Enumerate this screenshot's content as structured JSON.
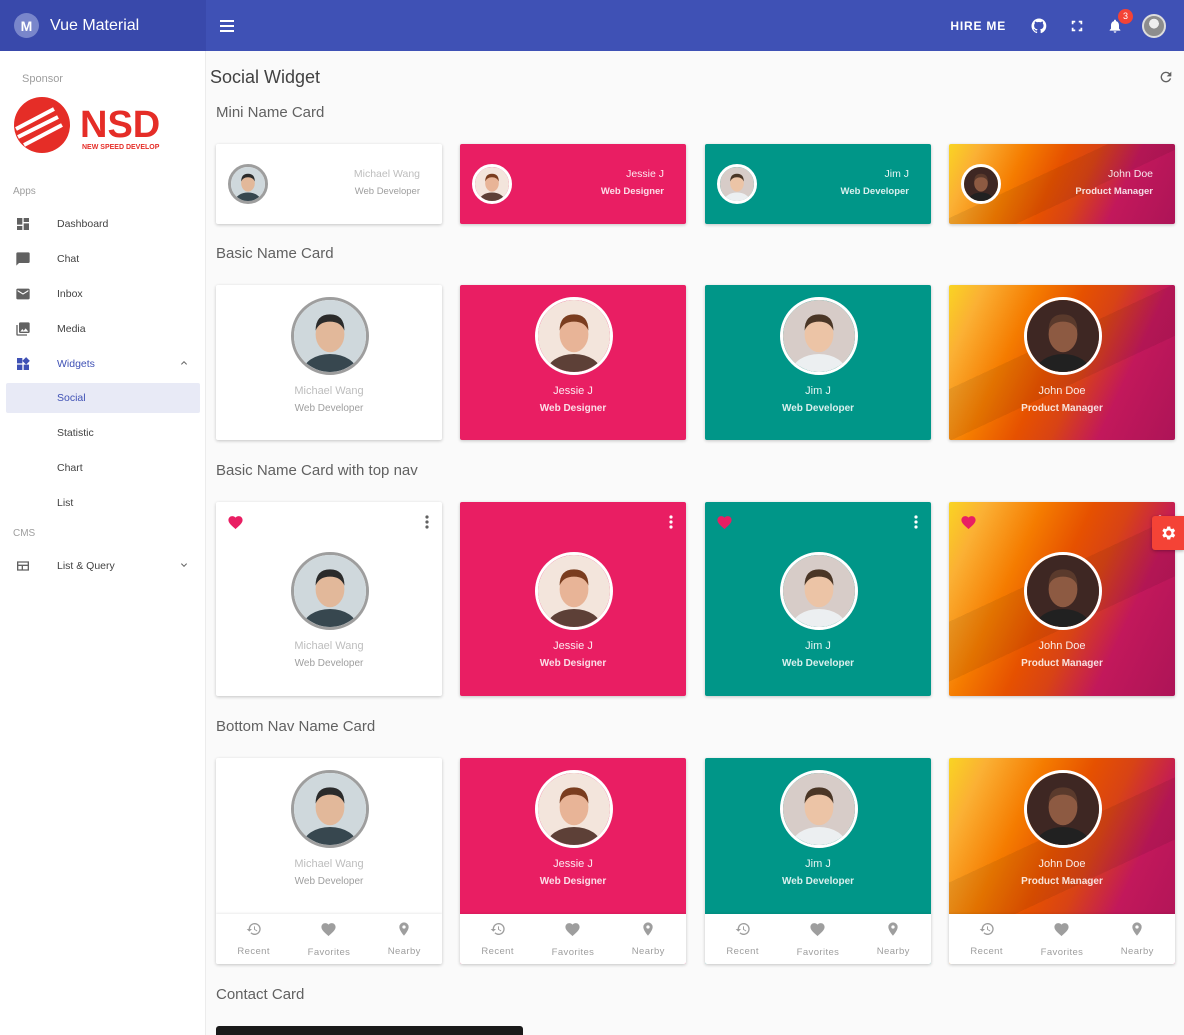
{
  "app": {
    "title": "Vue Material",
    "logo_letter": "M"
  },
  "header": {
    "hire_label": "HIRE ME",
    "notifications_count": "3"
  },
  "sidebar": {
    "sponsor_label": "Sponsor",
    "sponsor_name": "NSD",
    "sponsor_tagline": "NEW SPEED DEVELOP",
    "apps_header": "Apps",
    "cms_header": "CMS",
    "items": [
      {
        "label": "Dashboard",
        "icon": "dashboard-icon"
      },
      {
        "label": "Chat",
        "icon": "chat-icon"
      },
      {
        "label": "Inbox",
        "icon": "mail-icon"
      },
      {
        "label": "Media",
        "icon": "photo-library-icon"
      },
      {
        "label": "Widgets",
        "icon": "widgets-icon",
        "expanded": true
      }
    ],
    "widgets_children": [
      {
        "label": "Social",
        "active": true
      },
      {
        "label": "Statistic"
      },
      {
        "label": "Chart"
      },
      {
        "label": "List"
      }
    ],
    "cms_items": [
      {
        "label": "List & Query",
        "icon": "table-icon"
      }
    ]
  },
  "page": {
    "title": "Social Widget",
    "sections": {
      "mini": "Mini Name Card",
      "basic": "Basic Name Card",
      "topnav": "Basic Name Card with top nav",
      "bottomnav": "Bottom Nav Name Card",
      "contact": "Contact Card"
    }
  },
  "people": [
    {
      "name": "Michael Wang",
      "role": "Web Developer",
      "theme": "white"
    },
    {
      "name": "Jessie J",
      "role": "Web Designer",
      "theme": "pink"
    },
    {
      "name": "Jim J",
      "role": "Web Developer",
      "theme": "teal"
    },
    {
      "name": "John Doe",
      "role": "Product Manager",
      "theme": "abstract"
    }
  ],
  "bottom_nav": {
    "recent": "Recent",
    "favorites": "Favorites",
    "nearby": "Nearby"
  },
  "colors": {
    "primary": "#3f51b5",
    "primary_dark": "#3949ab",
    "pink": "#e91e63",
    "teal": "#009688",
    "accent": "#f44336"
  }
}
